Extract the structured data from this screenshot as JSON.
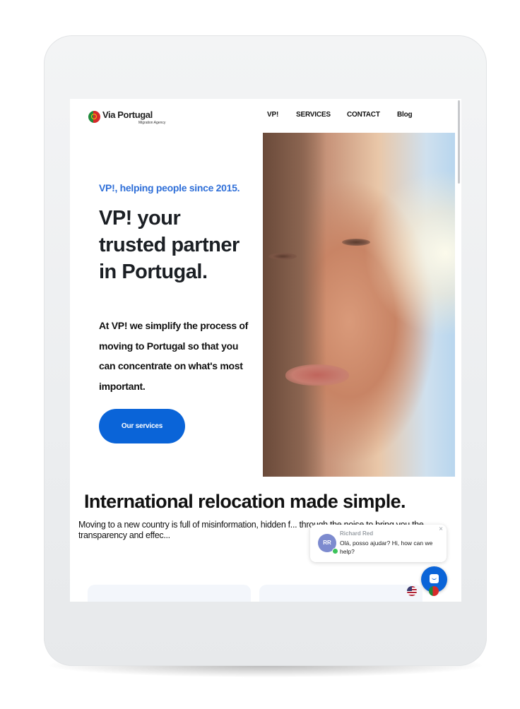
{
  "brand": {
    "name": "Via Portugal",
    "subtitle": "Migration Agency"
  },
  "nav": {
    "items": [
      "VP!",
      "SERVICES",
      "CONTACT",
      "Blog"
    ]
  },
  "hero": {
    "tagline": "VP!, helping people since 2015.",
    "headline": "VP! your trusted partner in Portugal.",
    "intro": "At VP! we simplify the process of moving to Portugal so that you can concentrate on what's most important.",
    "cta_label": "Our services"
  },
  "section": {
    "title": "International relocation made simple.",
    "text": "Moving to a new country is full of misinformation, hidden f... through the noise to bring you the transparency and effec..."
  },
  "chat": {
    "agent_initials": "RR",
    "agent_name": "Richard Red",
    "message": "Olá, posso ajudar? Hi, how can we help?",
    "close_glyph": "×"
  },
  "colors": {
    "accent": "#0a64d8",
    "tagline": "#2f6fd8"
  },
  "icons": {
    "logo": "portugal-flag-icon",
    "chat": "chat-bubble-icon",
    "lang_en": "us-flag-icon",
    "lang_pt": "portugal-flag-icon"
  }
}
